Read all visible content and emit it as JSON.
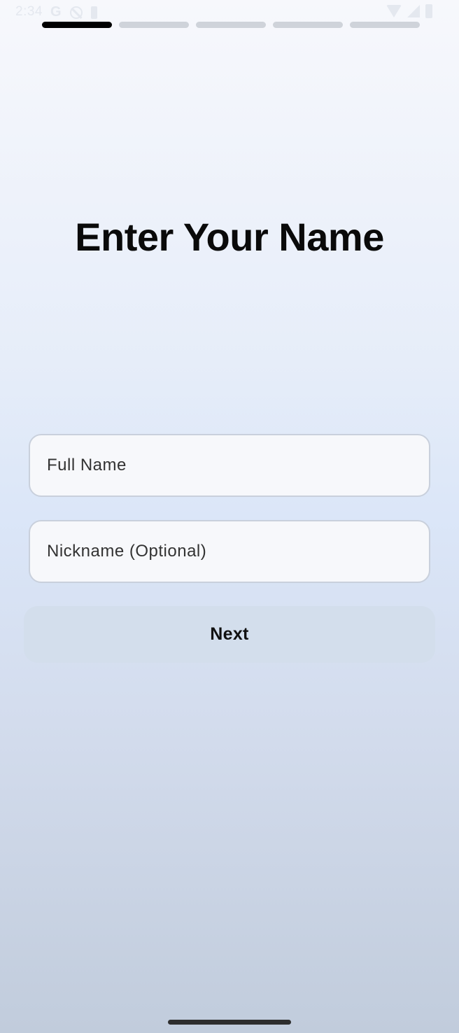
{
  "status_bar": {
    "time": "2:34",
    "network_letter": "G",
    "icons": [
      "google-icon",
      "do-not-disturb-icon",
      "battery-saver-icon",
      "wifi-icon",
      "signal-icon",
      "battery-icon"
    ]
  },
  "progress": {
    "total_steps": 5,
    "current_step": 1
  },
  "page": {
    "title": "Enter Your Name"
  },
  "form": {
    "full_name_placeholder": "Full Name",
    "full_name_value": "",
    "nickname_placeholder": "Nickname (Optional)",
    "nickname_value": "",
    "next_label": "Next"
  },
  "colors": {
    "progress_active": "#000000",
    "progress_inactive": "#cfd3da",
    "button_bg": "#d3deec",
    "field_bg": "#f7f8fb"
  }
}
